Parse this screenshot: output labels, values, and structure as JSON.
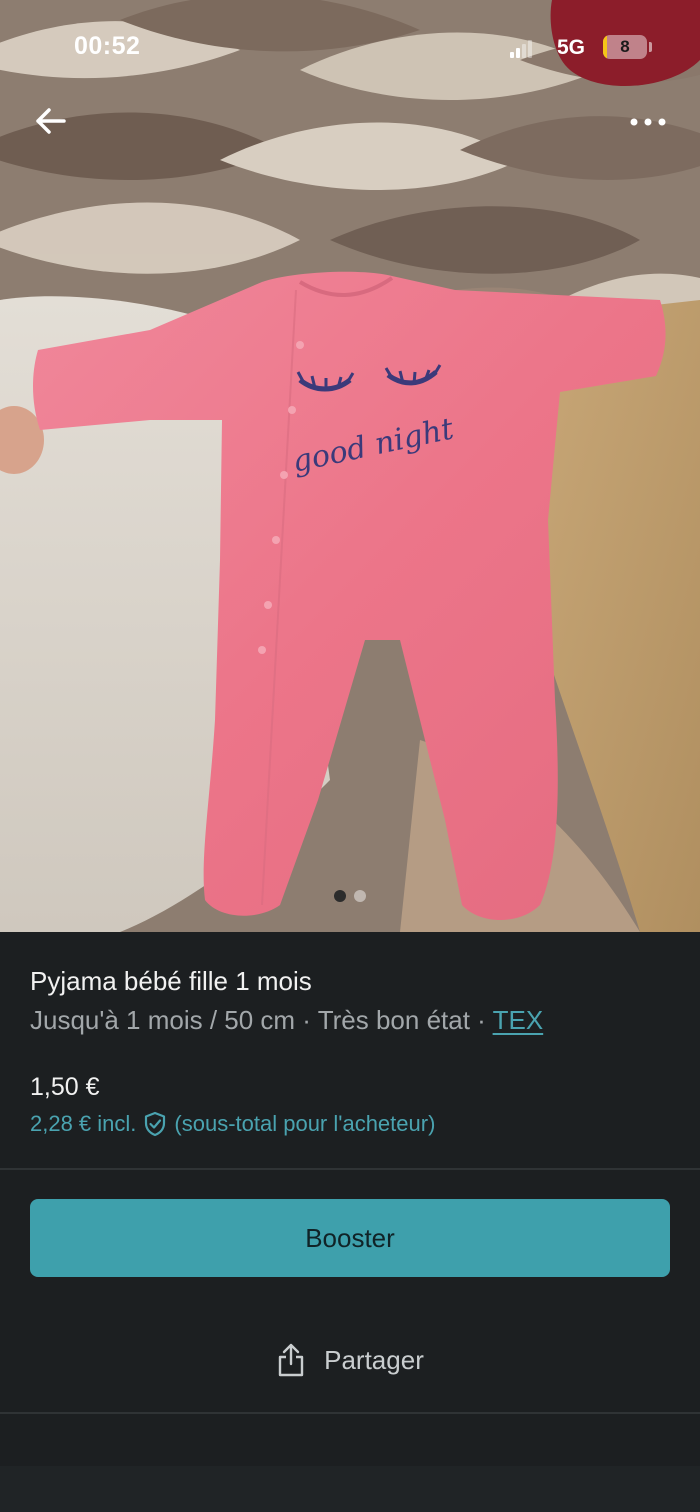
{
  "status_bar": {
    "time": "00:52",
    "network": "5G",
    "battery_level": "8",
    "battery_fraction": 0.08
  },
  "photo": {
    "print_text": "good night",
    "carousel": {
      "count": 2,
      "active_index": 0
    }
  },
  "item": {
    "title": "Pyjama bébé fille 1 mois",
    "meta": "Jusqu'à 1 mois / 50 cm · Très bon état · ",
    "brand": "TEX",
    "price": "1,50 €",
    "buyer_price": "2,28 € incl.",
    "buyer_price_note": "(sous-total pour l'acheteur)"
  },
  "actions": {
    "booster_label": "Booster",
    "share_label": "Partager"
  },
  "colors": {
    "accent": "#3ea0ac",
    "link": "#4aa3b0",
    "background": "#1c1f21",
    "battery_fill": "#f5c518",
    "garment": "#ee7d92"
  },
  "icons": [
    "signal-icon",
    "battery-icon",
    "back-arrow-icon",
    "more-dots-icon",
    "shield-check-icon",
    "share-icon"
  ]
}
